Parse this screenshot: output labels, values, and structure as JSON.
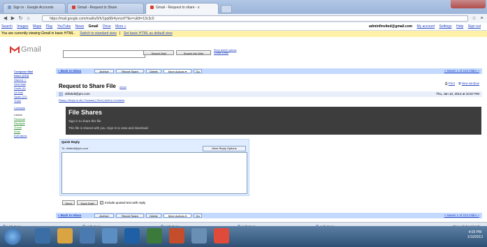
{
  "browser": {
    "tabs": [
      {
        "label": "Sign in - Google Accounts"
      },
      {
        "label": "Gmail - Request to Share"
      },
      {
        "label": "Gmail - Request to share - x"
      }
    ],
    "url": "https://mail.google.com/mail/u/0/h/1pq68r4yvnzrf/?&v=c&th=13c3c0"
  },
  "gbar": {
    "links": [
      "Search",
      "Images",
      "Maps",
      "Play",
      "YouTube",
      "News",
      "Gmail",
      "Drive",
      "More »"
    ],
    "account": "adminfinvited@gmail.com",
    "account_links": [
      "My account",
      "Settings",
      "Help",
      "Sign out"
    ]
  },
  "notice": {
    "text": "You are currently viewing Gmail in basic HTML.",
    "link1": "Switch to standard view",
    "link2": "Set basic HTML as default view"
  },
  "logo": {
    "text": "Gmail"
  },
  "search": {
    "placeholder": "",
    "search_mail": "Search Mail",
    "search_web": "Search the Web",
    "options": "Show search options",
    "filter": "Create a filter"
  },
  "leftnav": {
    "compose": "Compose Mail",
    "items": [
      "Inbox (213)",
      "Starred ☆",
      "Sent Mail",
      "Drafts (5)",
      "All Mail",
      "Spam (22)",
      "Trash"
    ],
    "contacts": "Contacts",
    "labels": [
      "Labels",
      "Personal",
      "Receipts",
      "Travel",
      "Work",
      "Edit labels"
    ]
  },
  "actionbar": {
    "back": "« Back to Inbox",
    "archive": "Archive",
    "report": "Report Spam",
    "delete": "Delete",
    "more": "More Actions",
    "go": "Go",
    "newer_older": "« Newer  1 of 213  Older »"
  },
  "message": {
    "subject": "Request to Share File",
    "inbox_label": "Inbox",
    "sender": "drifahdt@pm.com",
    "date": "Thu, Jan 10, 2013 at 10:57 PM",
    "reply_all": "Reply | Reply to all | Forward | Print | Add to Contacts",
    "print": "Print",
    "new_window": "New window"
  },
  "file_dialog": {
    "title": "File Shares",
    "line1": "Sign in to share this file",
    "line2": "This file is shared with you. Sign in to view and download."
  },
  "quick_reply": {
    "title": "Quick Reply",
    "to": "To: drifahdt@pm.com",
    "rich": "More Reply Options",
    "send": "Send",
    "save": "Save Draft",
    "include": "Include quoted text with reply"
  },
  "downloads": [
    {
      "label": "Linh Cuay"
    },
    {
      "label": "Linh Cuay"
    },
    {
      "label": "Linh Cuay"
    },
    {
      "label": "Linh Cuay"
    },
    {
      "label": "Linh Cuay"
    }
  ],
  "downloads_all": "Show all downloads...",
  "taskbar": {
    "time": "4:03 PM",
    "date": "1/10/2013"
  },
  "colors": {
    "accent": "#c3d9ff",
    "notice": "#fff1a8",
    "link": "#2a49c2",
    "gmail_red": "#d63b2f"
  }
}
